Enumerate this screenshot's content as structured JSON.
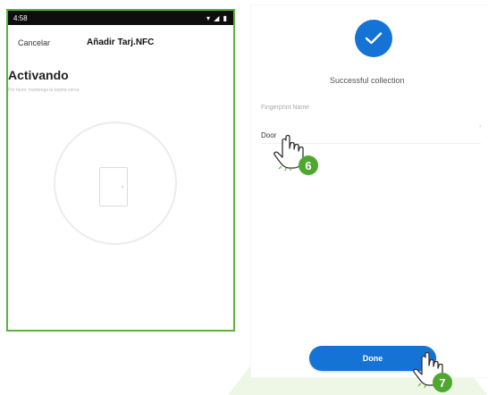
{
  "left_phone": {
    "status_time": "4:58",
    "status_icons": "▾ ◢ ▮",
    "cancel_label": "Cancelar",
    "title": "Añadir Tarj.NFC",
    "heading": "Activando",
    "subtitle": "Por favor, mantenga la tarjeta cerca"
  },
  "right_phone": {
    "success_text": "Successful collection",
    "field_label": "Fingerprint Name",
    "field_value": "Door",
    "field_arrow": "›",
    "done_label": "Done"
  },
  "steps": {
    "step6": "6",
    "step7": "7"
  },
  "colors": {
    "accent_blue": "#1673d6",
    "frame_green": "#5cb33a",
    "badge_green": "#4ea830"
  }
}
